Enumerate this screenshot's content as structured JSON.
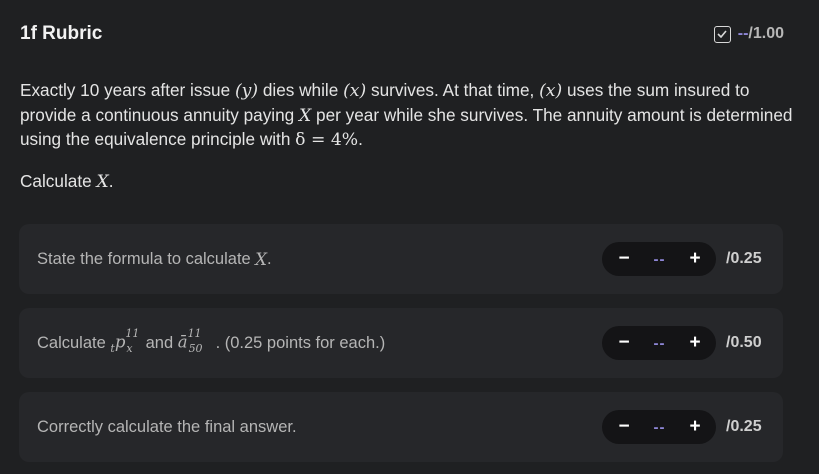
{
  "rubric": {
    "title": "1f Rubric",
    "score": "--",
    "max": "/1.00"
  },
  "question": {
    "s1": "Exactly 10 years after issue ",
    "y": "(y)",
    "s2": " dies while ",
    "x1": "(x)",
    "s3": " survives. At that time, ",
    "x2": "(x)",
    "s4": " uses the sum insured to provide a continuous annuity paying ",
    "X": "X",
    "s5": " per year while she survives. The annuity amount is determined using the equivalence principle with ",
    "delta": "δ = 4%",
    "s6": "."
  },
  "task": {
    "prefix": "Calculate ",
    "var": "X",
    "suffix": "."
  },
  "items": [
    {
      "label_prefix": "State the formula to calculate ",
      "label_var": "X",
      "label_suffix": ".",
      "value": "--",
      "max": "/0.25"
    },
    {
      "label_a": "Calculate ",
      "p_sub_left": "t",
      "p_base": "p",
      "p_sub": "x",
      "p_sup": "11",
      "label_b": " and ",
      "a_base": "ā",
      "a_sub": "50",
      "a_sup": "11",
      "label_c": ". (0.25 points for each.)",
      "value": "--",
      "max": "/0.50"
    },
    {
      "label": "Correctly calculate the final answer.",
      "value": "--",
      "max": "/0.25"
    }
  ],
  "stepper": {
    "minus": "−",
    "plus": "+"
  }
}
